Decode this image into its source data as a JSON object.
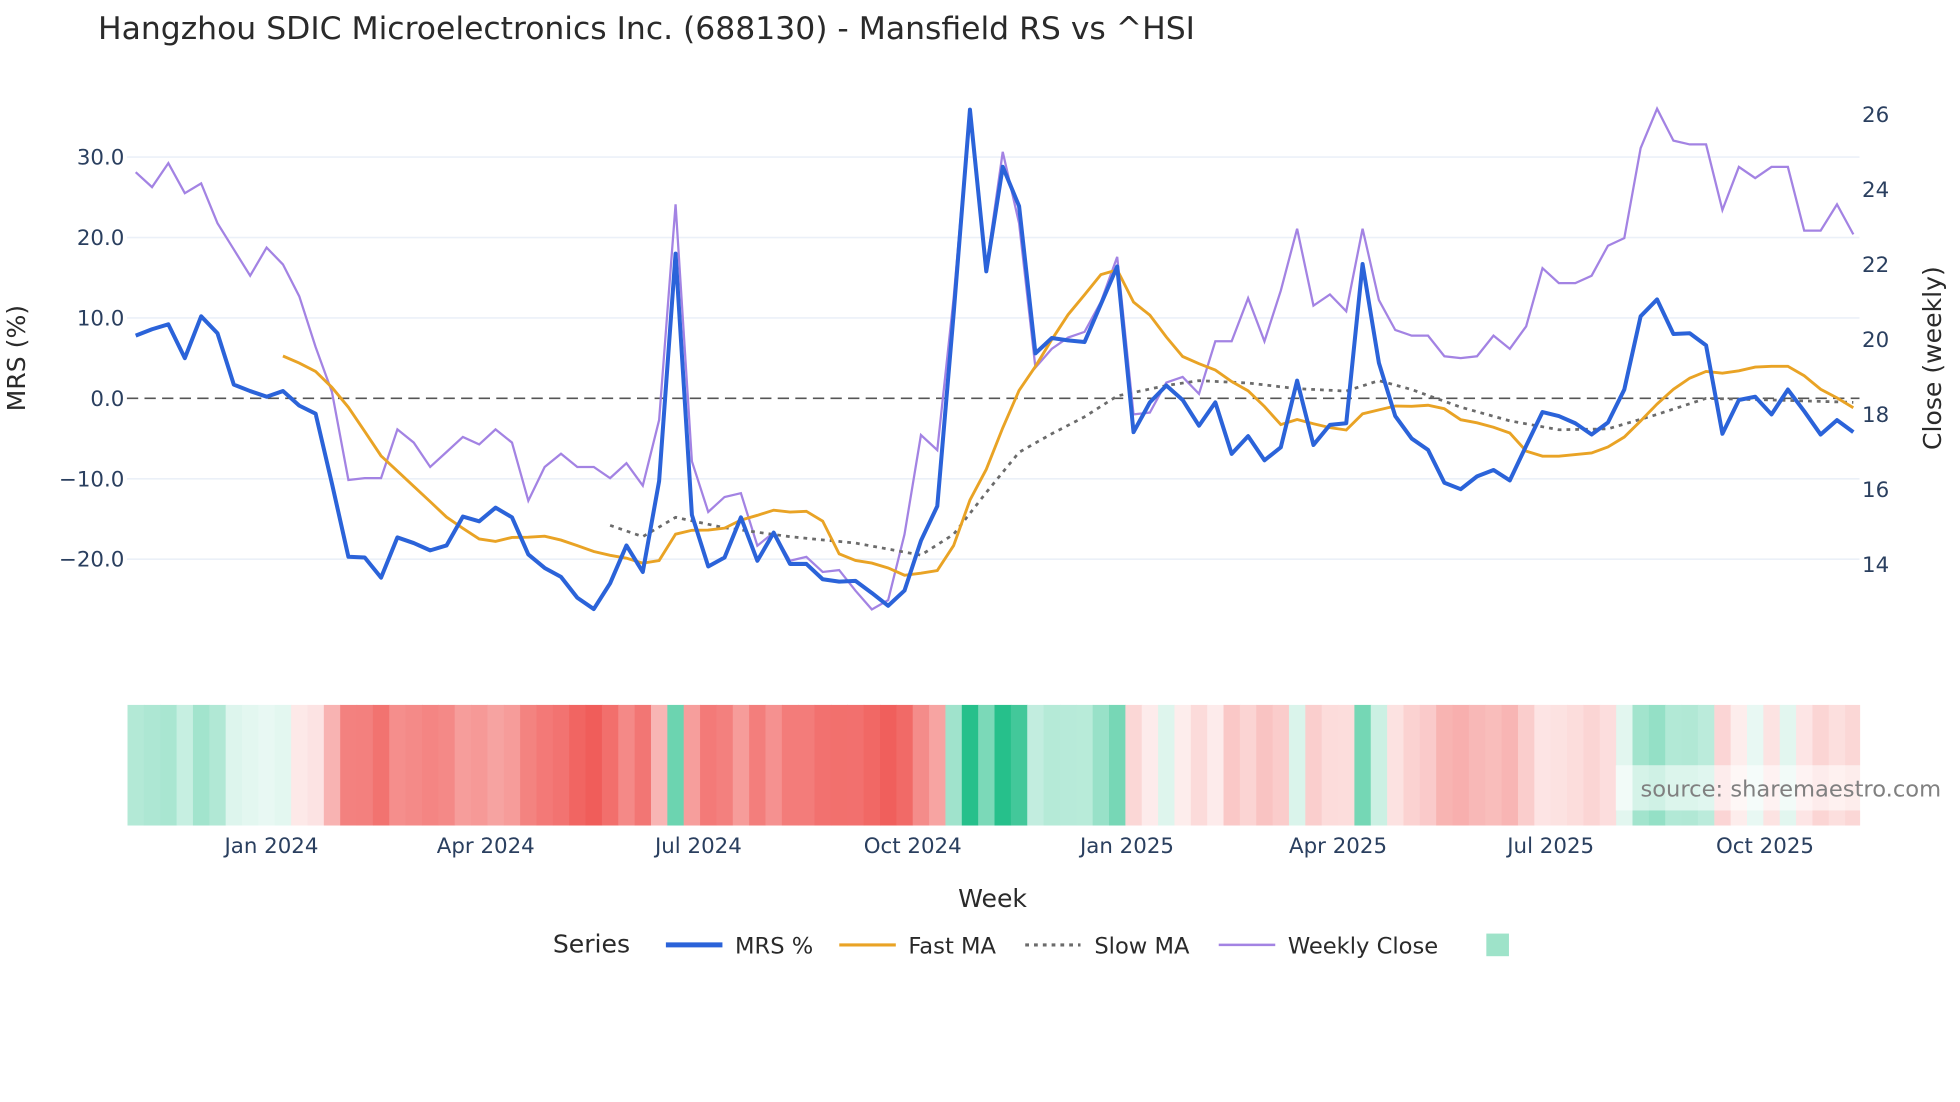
{
  "chart_data": {
    "type": "line",
    "title": "Hangzhou SDIC Microelectronics Inc. (688130) - Mansfield RS vs ^HSI",
    "xlabel": "Week",
    "ylabel_left": "MRS (%)",
    "ylabel_right": "Close (weekly)",
    "ylim_left": [
      -30,
      36
    ],
    "ylim_right": [
      12.5,
      26.2
    ],
    "left_ticks": [
      "30.0",
      "20.0",
      "10.0",
      "0.0",
      "−10.0",
      "−20.0"
    ],
    "left_tick_values": [
      30,
      20,
      10,
      0,
      -10,
      -20
    ],
    "right_ticks": [
      "26",
      "24",
      "22",
      "20",
      "18",
      "16",
      "14"
    ],
    "right_tick_values": [
      26,
      24,
      22,
      20,
      18,
      16,
      14
    ],
    "x_ticks": [
      "Jan 2024",
      "Apr 2024",
      "Jul 2024",
      "Oct 2024",
      "Jan 2025",
      "Apr 2025",
      "Jul 2025",
      "Oct 2025"
    ],
    "x_tick_week_index": [
      8.3,
      21.4,
      34.4,
      47.5,
      60.6,
      73.5,
      86.5,
      99.6
    ],
    "first_week": "2023-11-03",
    "grid": true,
    "zero_line": "dashed",
    "legend": {
      "title": "Series",
      "placement": "bottom",
      "entries": [
        "MRS %",
        "Fast MA",
        "Slow MA",
        "Weekly Close"
      ]
    },
    "fast_ma_window": 10,
    "series": [
      {
        "name": "MRS %",
        "axis": "left",
        "color": "#2b63d9",
        "values": [
          7.8,
          8.6,
          9.2,
          5.0,
          10.2,
          8.1,
          1.7,
          0.9,
          0.2,
          0.9,
          -0.9,
          -1.9,
          -10.6,
          -19.7,
          -19.8,
          -22.3,
          -17.3,
          -18.0,
          -18.9,
          -18.3,
          -14.7,
          -15.3,
          -13.6,
          -14.8,
          -19.4,
          -21.1,
          -22.2,
          -24.8,
          -26.2,
          -23.0,
          -18.3,
          -21.6,
          -10.3,
          18.0,
          -14.5,
          -20.9,
          -19.8,
          -14.8,
          -20.2,
          -16.7,
          -20.6,
          -20.6,
          -22.5,
          -22.8,
          -22.7,
          -24.2,
          -25.8,
          -23.9,
          -17.7,
          -13.4,
          10.5,
          35.9,
          15.8,
          28.8,
          23.9,
          5.6,
          7.5,
          7.2,
          7.0,
          11.7,
          16.4,
          -4.2,
          -0.5,
          1.6,
          -0.2,
          -3.4,
          -0.5,
          -6.9,
          -4.7,
          -7.7,
          -6.1,
          2.2,
          -5.8,
          -3.3,
          -3.1,
          16.7,
          4.4,
          -2.2,
          -5.0,
          -6.4,
          -10.5,
          -11.3,
          -9.7,
          -8.9,
          -10.2,
          -5.9,
          -1.7,
          -2.2,
          -3.1,
          -4.5,
          -3.0,
          1.1,
          10.2,
          12.3,
          8.0,
          8.1,
          6.6,
          -4.4,
          -0.2,
          0.2,
          -2.0,
          1.1,
          -1.6,
          -4.5,
          -2.7,
          -4.2
        ]
      },
      {
        "name": "Fast MA",
        "axis": "left",
        "color": "#e9a325",
        "derived": "10-week moving average of MRS %"
      },
      {
        "name": "Slow MA",
        "axis": "left",
        "color": "#6b6b6b",
        "points": [
          [
            29,
            -15.8
          ],
          [
            31,
            -17.2
          ],
          [
            33,
            -14.8
          ],
          [
            36,
            -16.1
          ],
          [
            40,
            -17.2
          ],
          [
            44,
            -18.0
          ],
          [
            48,
            -19.5
          ],
          [
            50,
            -16.9
          ],
          [
            52,
            -11.7
          ],
          [
            54,
            -6.7
          ],
          [
            56,
            -4.4
          ],
          [
            58,
            -2.3
          ],
          [
            60,
            0.3
          ],
          [
            63,
            1.6
          ],
          [
            65,
            2.2
          ],
          [
            68,
            1.9
          ],
          [
            71,
            1.2
          ],
          [
            74,
            0.9
          ],
          [
            76,
            2.2
          ],
          [
            78,
            1.1
          ],
          [
            81,
            -1.1
          ],
          [
            84,
            -2.8
          ],
          [
            87,
            -3.9
          ],
          [
            90,
            -3.8
          ],
          [
            93,
            -2.0
          ],
          [
            96,
            0.0
          ],
          [
            100,
            -0.2
          ],
          [
            105,
            -0.5
          ]
        ]
      },
      {
        "name": "Weekly Close",
        "axis": "right",
        "color": "#a383e3",
        "values": [
          24.46,
          24.06,
          24.7,
          23.9,
          24.16,
          23.1,
          22.4,
          21.7,
          22.45,
          22.0,
          21.15,
          19.8,
          18.6,
          16.25,
          16.3,
          16.3,
          17.6,
          17.25,
          16.6,
          17.0,
          17.4,
          17.2,
          17.6,
          17.25,
          15.7,
          16.6,
          16.95,
          16.6,
          16.6,
          16.3,
          16.7,
          16.1,
          17.85,
          23.6,
          16.75,
          15.4,
          15.8,
          15.9,
          14.5,
          14.85,
          14.1,
          14.2,
          13.8,
          13.85,
          13.3,
          12.8,
          13.05,
          14.8,
          17.45,
          17.05,
          21.1,
          26.1,
          21.9,
          25.0,
          23.1,
          19.25,
          19.75,
          20.05,
          20.2,
          21.0,
          22.2,
          18.0,
          18.05,
          18.85,
          19.0,
          18.55,
          19.95,
          19.95,
          21.1,
          19.95,
          21.3,
          22.95,
          20.9,
          21.2,
          20.75,
          22.95,
          21.05,
          20.25,
          20.1,
          20.1,
          19.55,
          19.5,
          19.55,
          20.1,
          19.75,
          20.35,
          21.9,
          21.5,
          21.5,
          21.7,
          22.5,
          22.7,
          25.1,
          26.15,
          25.3,
          25.2,
          25.2,
          23.45,
          24.6,
          24.3,
          24.6,
          24.6,
          22.9,
          22.9,
          23.6,
          22.8
        ]
      }
    ],
    "heatmap": {
      "source": "MRS %",
      "positive_color": "#26c08b",
      "negative_color": "#ef5350"
    }
  },
  "watermark": "source: sharemaestro.com"
}
